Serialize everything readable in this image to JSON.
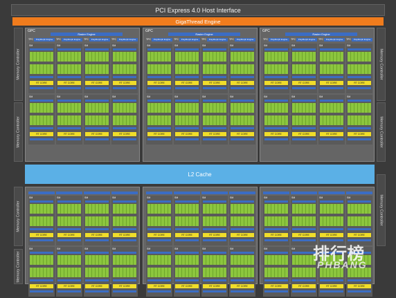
{
  "header": {
    "host_interface": "PCI Express 4.0 Host Interface",
    "engine": "GigaThread Engine"
  },
  "memory_controller_label": "Memory Controller",
  "l2_cache_label": "L2 Cache",
  "gpc": {
    "label": "GPC",
    "raster_label": "Raster Engine",
    "tpc_label": "TPC",
    "polymorph_label": "PolyMorph Engine",
    "sm_label": "SM",
    "rt_core_label": "RT CORE"
  },
  "watermark": {
    "cn": "排行榜",
    "en": "PHBANG"
  },
  "colors": {
    "background": "#3a3a3a",
    "gigathread": "#f07c1d",
    "l2_cache": "#5bb0e6",
    "cuda_core": "#8cc63e",
    "rt_core": "#f0dd2a",
    "engine_blue": "#3b6dc4"
  }
}
